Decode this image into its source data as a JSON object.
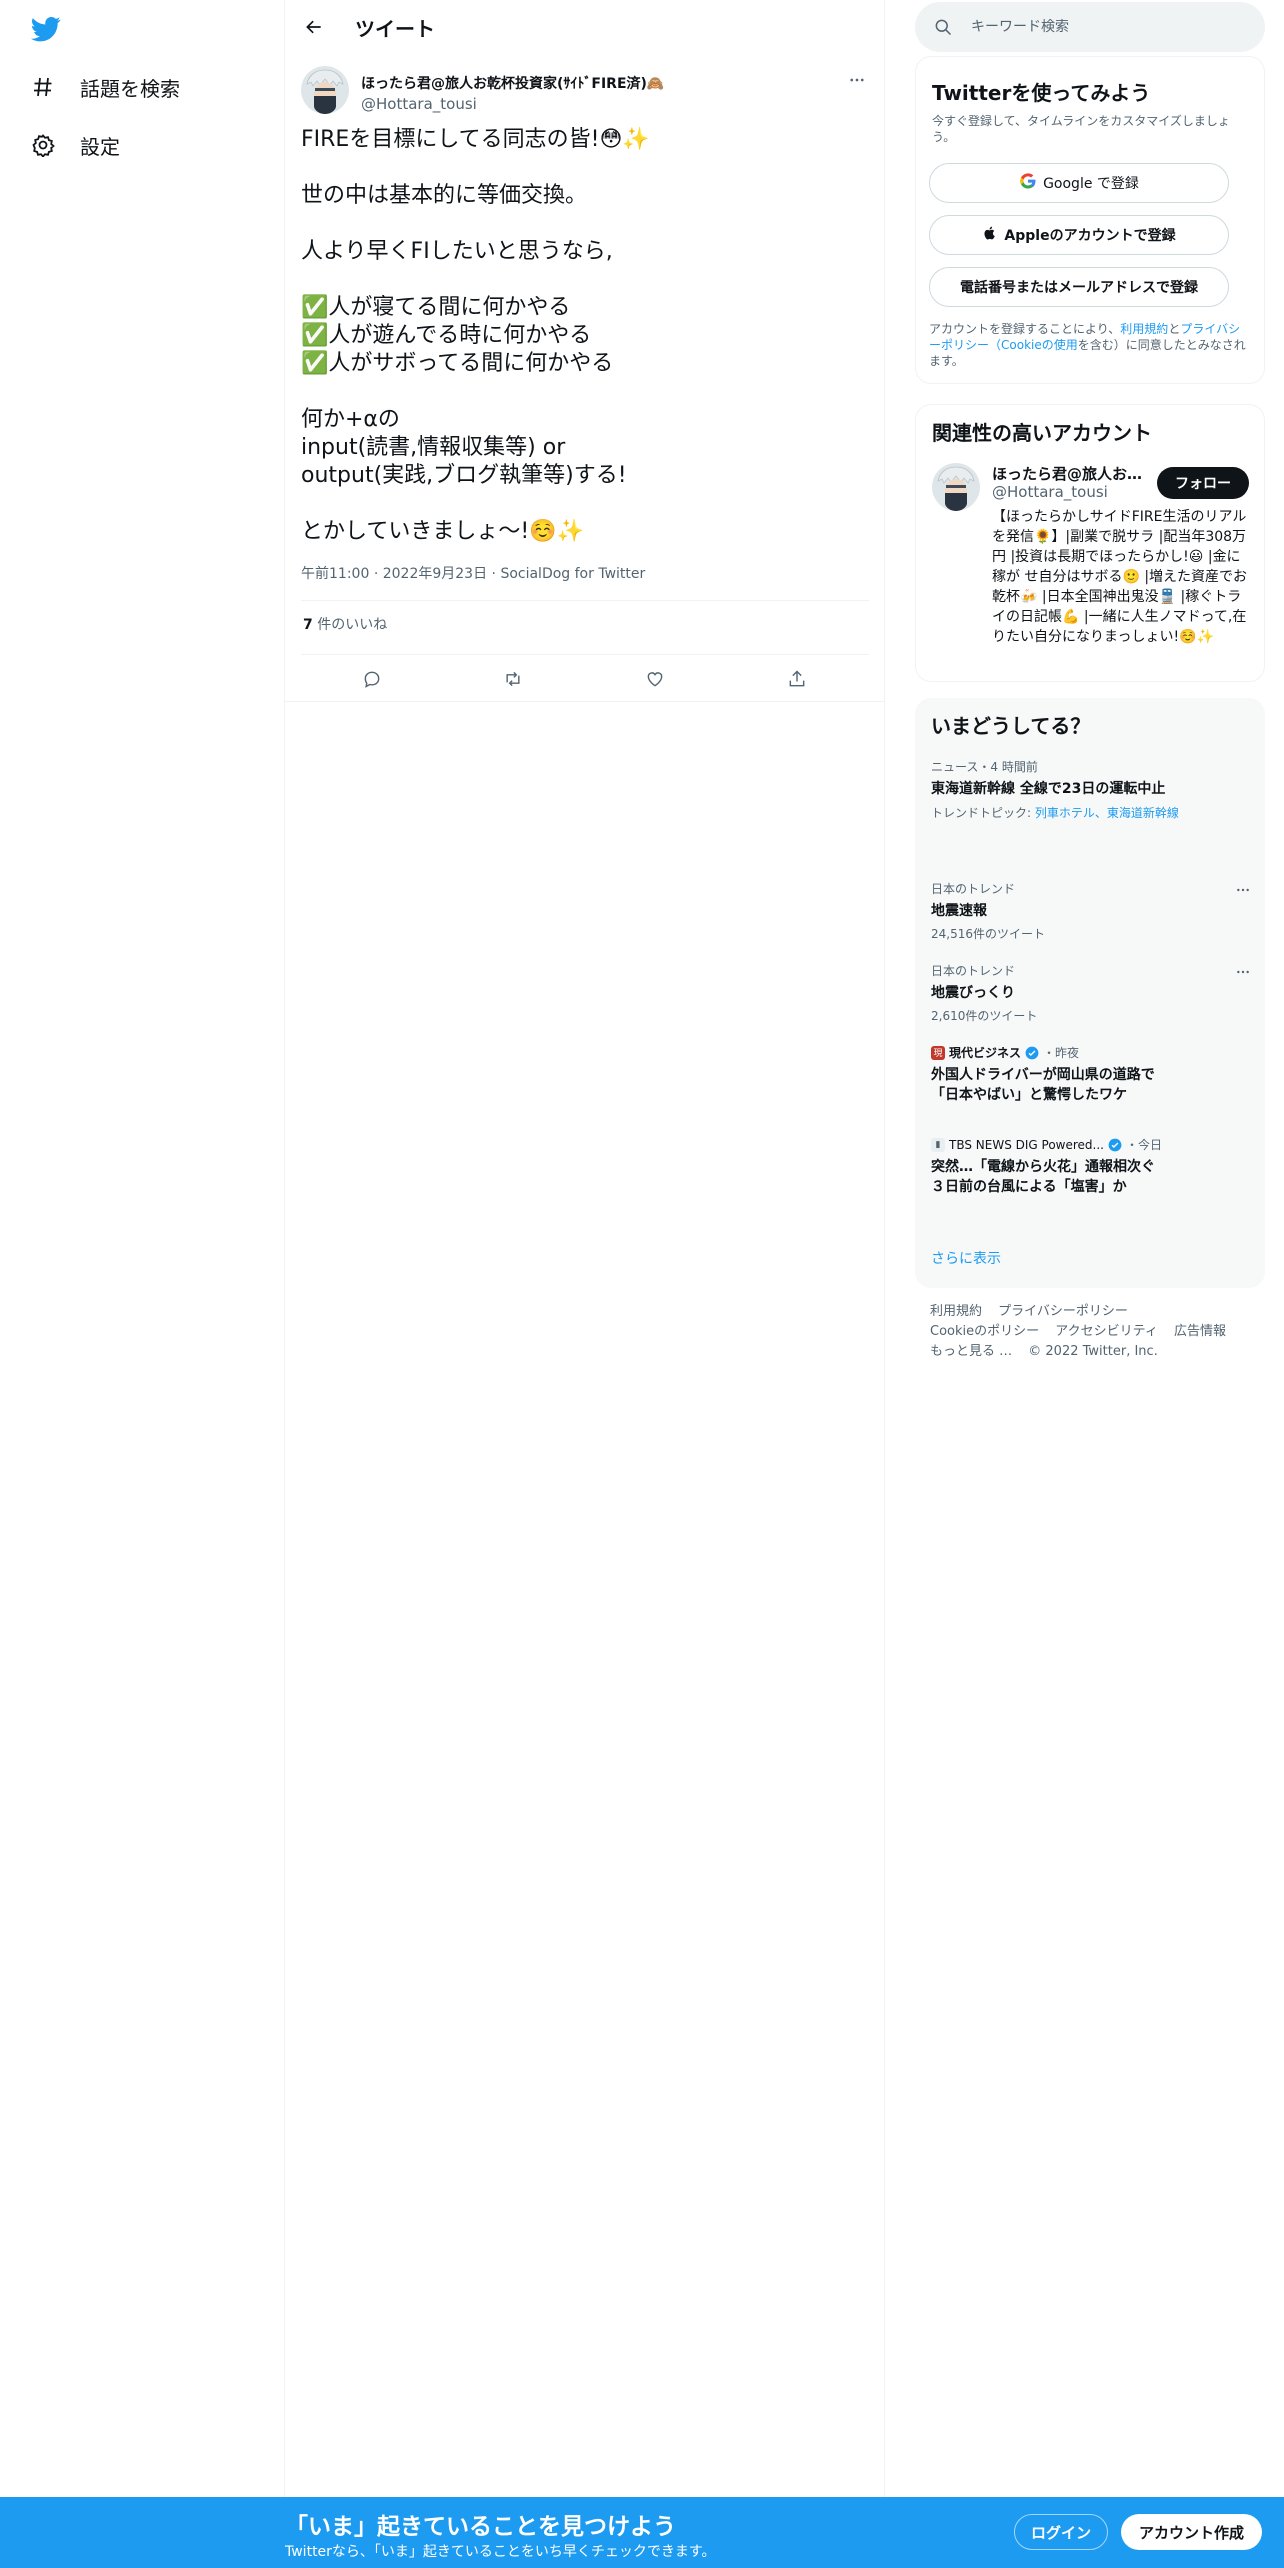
{
  "nav": {
    "items": [
      {
        "label": "話題を検索"
      },
      {
        "label": "設定"
      }
    ]
  },
  "header": {
    "title": "ツイート"
  },
  "tweet": {
    "author_name": "ほったら君@旅人お乾杯投資家(ｻｲﾄﾞFIRE済)🙈",
    "author_handle": "@Hottara_tousi",
    "body": "FIREを目標にしてる同志の皆!😳✨\n\n世の中は基本的に等価交換。\n\n人より早くFIしたいと思うなら,\n\n✅人が寝てる間に何かやる\n✅人が遊んでる時に何かやる\n✅人がサボってる間に何かやる\n\n何か+αの\ninput(読書,情報収集等) or\noutput(実践,ブログ執筆等)する!\n\nとかしていきましょ〜!☺️✨",
    "time": "午前11:00",
    "date": "2022年9月23日",
    "source": "SocialDog for Twitter",
    "likes_count": "7",
    "likes_label": "件のいいね"
  },
  "search": {
    "placeholder": "キーワード検索"
  },
  "signup": {
    "title": "Twitterを使ってみよう",
    "subtitle": "今すぐ登録して、タイムラインをカスタマイズしましょう。",
    "google_label": "Google で登録",
    "apple_label": "Appleのアカウントで登録",
    "phone_label": "電話番号またはメールアドレスで登録",
    "terms_prefix": "アカウントを登録することにより、",
    "terms_link1": "利用規約",
    "terms_and": "と",
    "terms_link2": "プライバシーポリシー（Cookieの使用",
    "terms_suffix": "を含む）に同意したとみなされます。"
  },
  "related": {
    "title": "関連性の高いアカウント",
    "name": "ほったら君@旅人お乾杯投資家(ｻｲﾄﾞFIRE済)",
    "handle": "@Hottara_tousi",
    "follow_label": "フォロー",
    "bio": "【ほったらかしサイドFIRE生活のリアルを発信🌻】|副業で脱サラ |配当年308万円 |投資は長期でほったらかし!😃 |金に稼が せ自分はサボる🙂 |増えた資産でお乾杯🍻 |日本全国神出鬼没🚆 |稼ぐトライの日記帳💪 |一緒に人生ノマドって,在りたい自分になりまっしょい!☺️✨"
  },
  "trends": {
    "title": "いまどうしてる？",
    "items": [
      {
        "meta": "ニュース・4 時間前",
        "title": "東海道新幹線 全線で23日の運転中止",
        "topic_prefix": "トレンドトピック: ",
        "topic_links": "列車ホテル、東海道新幹線"
      },
      {
        "meta": "日本のトレンド",
        "title": "地震速報",
        "count": "24,516件のツイート"
      },
      {
        "meta": "日本のトレンド",
        "title": "地震びっくり",
        "count": "2,610件のツイート"
      },
      {
        "source": "現代ビジネス",
        "time": "・昨夜",
        "title": "外国人ドライバーが岡山県の道路で「日本やばい」と驚愕したワケ"
      },
      {
        "source": "TBS NEWS DIG Powered...",
        "time": "・今日",
        "title": "突然…「電線から火花」通報相次ぐ　３日前の台風による「塩害」か"
      }
    ],
    "show_more": "さらに表示"
  },
  "footer": {
    "links": [
      "利用規約",
      "プライバシーポリシー",
      "Cookieのポリシー",
      "アクセシビリティ",
      "広告情報",
      "もっと見る …",
      "© 2022 Twitter, Inc."
    ]
  },
  "banner": {
    "title": "「いま」起きていることを見つけよう",
    "subtitle": "Twitterなら、「いま」起きていることをいち早くチェックできます。",
    "login_label": "ログイン",
    "signup_label": "アカウント作成"
  },
  "colors": {
    "accent": "#1d9bf0",
    "text": "#0f1419",
    "muted": "#536471",
    "border": "#eff3f4",
    "trend_bg": "#f7f9f9"
  }
}
